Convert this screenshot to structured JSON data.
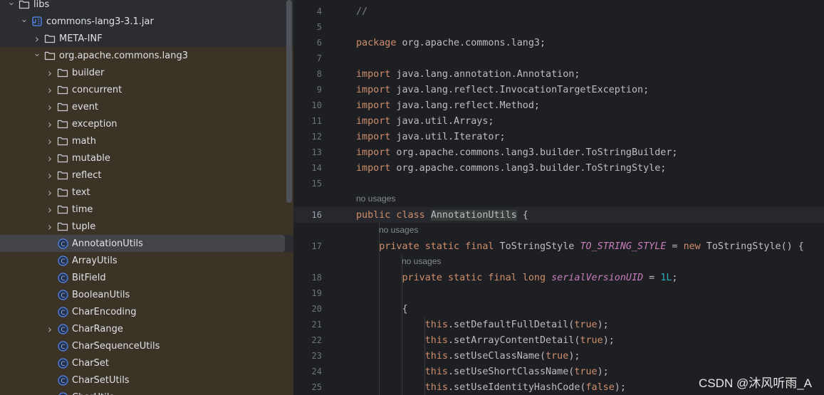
{
  "project_tree": {
    "rows": [
      {
        "label": "libs",
        "level": 0,
        "chevron": "down",
        "icon": "folder"
      },
      {
        "label": "commons-lang3-3.1.jar",
        "level": 1,
        "chevron": "down",
        "icon": "jar"
      },
      {
        "label": "META-INF",
        "level": 2,
        "chevron": "right",
        "icon": "folder"
      },
      {
        "label": "org.apache.commons.lang3",
        "level": 2,
        "chevron": "down",
        "icon": "folder"
      },
      {
        "label": "builder",
        "level": 3,
        "chevron": "right",
        "icon": "folder"
      },
      {
        "label": "concurrent",
        "level": 3,
        "chevron": "right",
        "icon": "folder"
      },
      {
        "label": "event",
        "level": 3,
        "chevron": "right",
        "icon": "folder"
      },
      {
        "label": "exception",
        "level": 3,
        "chevron": "right",
        "icon": "folder"
      },
      {
        "label": "math",
        "level": 3,
        "chevron": "right",
        "icon": "folder"
      },
      {
        "label": "mutable",
        "level": 3,
        "chevron": "right",
        "icon": "folder"
      },
      {
        "label": "reflect",
        "level": 3,
        "chevron": "right",
        "icon": "folder"
      },
      {
        "label": "text",
        "level": 3,
        "chevron": "right",
        "icon": "folder"
      },
      {
        "label": "time",
        "level": 3,
        "chevron": "right",
        "icon": "folder"
      },
      {
        "label": "tuple",
        "level": 3,
        "chevron": "right",
        "icon": "folder"
      },
      {
        "label": "AnnotationUtils",
        "level": 3,
        "chevron": "none",
        "icon": "class",
        "selected": true
      },
      {
        "label": "ArrayUtils",
        "level": 3,
        "chevron": "none",
        "icon": "class"
      },
      {
        "label": "BitField",
        "level": 3,
        "chevron": "none",
        "icon": "class"
      },
      {
        "label": "BooleanUtils",
        "level": 3,
        "chevron": "none",
        "icon": "class"
      },
      {
        "label": "CharEncoding",
        "level": 3,
        "chevron": "none",
        "icon": "class"
      },
      {
        "label": "CharRange",
        "level": 3,
        "chevron": "right",
        "icon": "class"
      },
      {
        "label": "CharSequenceUtils",
        "level": 3,
        "chevron": "none",
        "icon": "class"
      },
      {
        "label": "CharSet",
        "level": 3,
        "chevron": "none",
        "icon": "class"
      },
      {
        "label": "CharSetUtils",
        "level": 3,
        "chevron": "none",
        "icon": "class"
      },
      {
        "label": "CharUtils",
        "level": 3,
        "chevron": "none",
        "icon": "class"
      }
    ]
  },
  "editor": {
    "current_line": 16,
    "hint_text": "no usages",
    "lines": [
      {
        "n": 4,
        "html": "<span class=\"cm\">//</span>"
      },
      {
        "n": 5,
        "html": ""
      },
      {
        "n": 6,
        "html": "<span class=\"kw\">package</span> org.apache.commons.lang3;"
      },
      {
        "n": 7,
        "html": ""
      },
      {
        "n": 8,
        "html": "<span class=\"kw\">import</span> java.lang.annotation.Annotation;"
      },
      {
        "n": 9,
        "html": "<span class=\"kw\">import</span> java.lang.reflect.InvocationTargetException;"
      },
      {
        "n": 10,
        "html": "<span class=\"kw\">import</span> java.lang.reflect.Method;"
      },
      {
        "n": 11,
        "html": "<span class=\"kw\">import</span> java.util.Arrays;"
      },
      {
        "n": 12,
        "html": "<span class=\"kw\">import</span> java.util.Iterator;"
      },
      {
        "n": 13,
        "html": "<span class=\"kw\">import</span> org.apache.commons.lang3.builder.ToStringBuilder;"
      },
      {
        "n": 14,
        "html": "<span class=\"kw\">import</span> org.apache.commons.lang3.builder.ToStringStyle;"
      },
      {
        "n": 15,
        "html": ""
      },
      {
        "n": 16,
        "html": "<span class=\"kw\">public class</span> <span class=\"caret-word\">AnnotationUtils</span> {",
        "hint_before": true,
        "indent": 0
      },
      {
        "n": 17,
        "html": "    <span class=\"kw\">private static final</span> ToStringStyle <span class=\"sf\">TO_STRING_STYLE</span> = <span class=\"kw\">new</span> ToStringStyle() {",
        "hint_before": true,
        "indent": 1
      },
      {
        "n": 18,
        "html": "        <span class=\"kw\">private static final long</span> <span class=\"sf\">serialVersionUID</span> = <span class=\"num\">1L</span>;",
        "hint_before": true,
        "indent": 2
      },
      {
        "n": 19,
        "html": ""
      },
      {
        "n": 20,
        "html": "        {"
      },
      {
        "n": 21,
        "html": "            <span class=\"kw\">this</span>.setDefaultFullDetail(<span class=\"kw\">true</span>);"
      },
      {
        "n": 22,
        "html": "            <span class=\"kw\">this</span>.setArrayContentDetail(<span class=\"kw\">true</span>);"
      },
      {
        "n": 23,
        "html": "            <span class=\"kw\">this</span>.setUseClassName(<span class=\"kw\">true</span>);"
      },
      {
        "n": 24,
        "html": "            <span class=\"kw\">this</span>.setUseShortClassName(<span class=\"kw\">true</span>);"
      },
      {
        "n": 25,
        "html": "            <span class=\"kw\">this</span>.setUseIdentityHashCode(<span class=\"kw\">false</span>);"
      }
    ]
  },
  "watermark": "CSDN @沐风听雨_A",
  "colors": {
    "tree_bg": "#2b2d30",
    "tree_highlight": "#3a3326",
    "selected": "#43454a",
    "editor_bg": "#1e1f22",
    "keyword": "#cf8e6d",
    "number": "#2aacb8",
    "static_field": "#c77dbb"
  }
}
